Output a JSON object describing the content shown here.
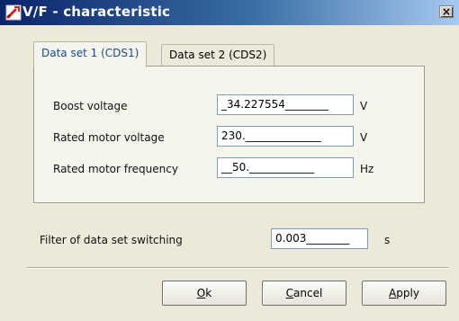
{
  "window": {
    "title": "V/F - characteristic",
    "close_symbol": "×",
    "title_icon": "app-wrench-icon"
  },
  "tabs": [
    {
      "label": "Data set 1 (CDS1)",
      "active": true
    },
    {
      "label": "Data set 2 (CDS2)",
      "active": false
    }
  ],
  "params": [
    {
      "label": "Boost voltage",
      "value": "_34.227554________",
      "unit": "V"
    },
    {
      "label": "Rated motor voltage",
      "value": "230.______________",
      "unit": "V"
    },
    {
      "label": "Rated motor frequency",
      "value": "__50.____________",
      "unit": "Hz"
    }
  ],
  "filter": {
    "label": "Filter of data set switching",
    "value": "0.003________",
    "unit": "s"
  },
  "buttons": {
    "ok": {
      "mnemonic": "O",
      "rest": "k"
    },
    "cancel": {
      "mnemonic": "C",
      "rest": "ancel"
    },
    "apply": {
      "mnemonic": "A",
      "rest": "pply"
    }
  },
  "colors": {
    "title_gradient_start": "#0a246a",
    "title_gradient_end": "#a6caf0",
    "dialog_bg": "#ece9d8",
    "active_tab_text": "#1c4b8c",
    "field_border": "#7f9db9"
  }
}
